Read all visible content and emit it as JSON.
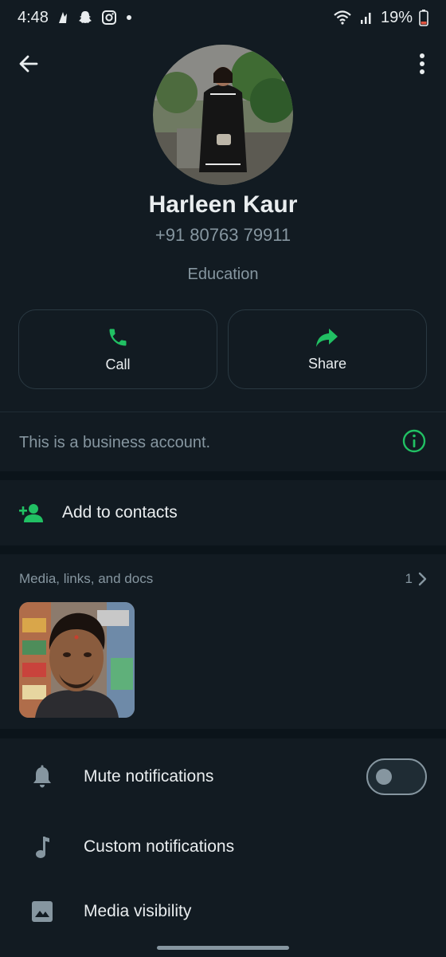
{
  "status_bar": {
    "time": "4:48",
    "battery": "19%"
  },
  "profile": {
    "name": "Harleen Kaur",
    "phone": "+91 80763 79911",
    "category": "Education"
  },
  "actions": {
    "call_label": "Call",
    "share_label": "Share"
  },
  "business_notice": "This is a business account.",
  "add_contacts_label": "Add to contacts",
  "media": {
    "title": "Media, links, and docs",
    "count": "1"
  },
  "settings": {
    "mute_label": "Mute notifications",
    "mute_enabled": false,
    "custom_label": "Custom notifications",
    "visibility_label": "Media visibility"
  },
  "colors": {
    "background": "#121b22",
    "accent": "#21c063",
    "secondary_text": "#8696a0"
  },
  "icons": [
    "back-arrow-icon",
    "more-vertical-icon",
    "phone-icon",
    "share-arrow-icon",
    "info-icon",
    "add-person-icon",
    "chevron-right-icon",
    "bell-icon",
    "music-note-icon",
    "image-icon"
  ]
}
